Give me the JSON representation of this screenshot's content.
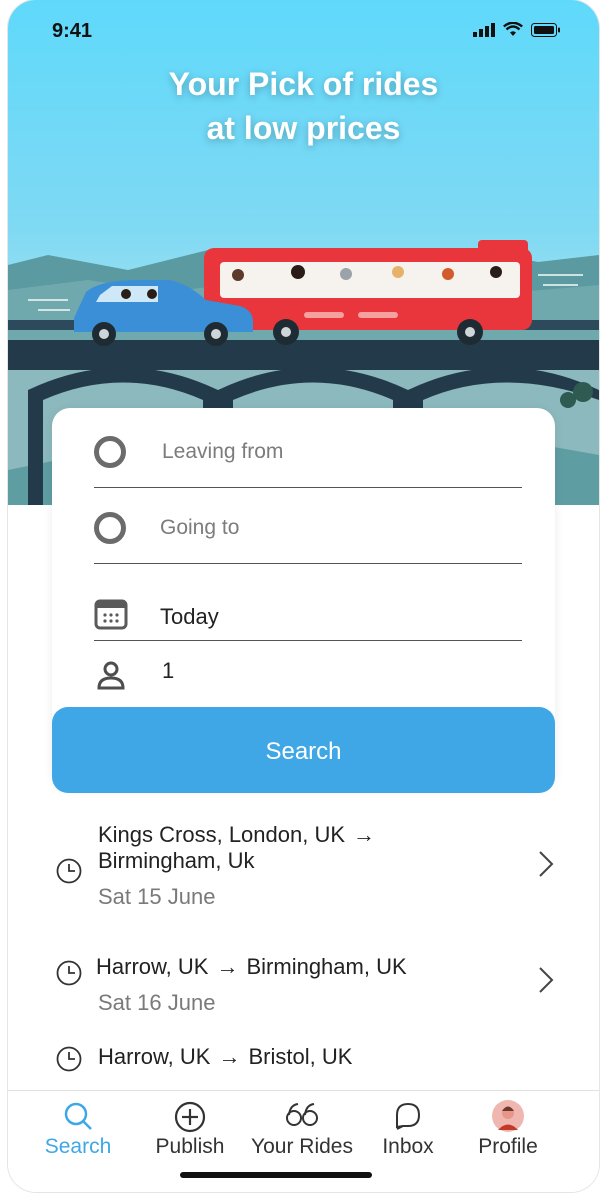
{
  "status": {
    "time": "9:41"
  },
  "hero": {
    "title_line1": "Your Pick of rides",
    "title_line2": "at low prices"
  },
  "search_form": {
    "from_placeholder": "Leaving from",
    "to_placeholder": "Going to",
    "date_value": "Today",
    "passengers_value": "1",
    "search_label": "Search"
  },
  "recent": [
    {
      "from": "Kings Cross, London, UK",
      "to": "Birmingham, Uk",
      "arrow": "→",
      "date": "Sat 15 June"
    },
    {
      "from": "Harrow, UK",
      "to": "Birmingham, UK",
      "arrow": "→",
      "date": "Sat 16 June"
    },
    {
      "from": "Harrow, UK",
      "to": "Bristol, UK",
      "arrow": "→",
      "date": ""
    }
  ],
  "tabs": [
    {
      "label": "Search",
      "icon": "search-icon",
      "active": true
    },
    {
      "label": "Publish",
      "icon": "plus-circle-icon"
    },
    {
      "label": "Your Rides",
      "icon": "quote-icon"
    },
    {
      "label": "Inbox",
      "icon": "chat-icon"
    },
    {
      "label": "Profile",
      "icon": "avatar-icon"
    }
  ],
  "colors": {
    "accent": "#3fa7e6",
    "bus": "#e8363c",
    "car": "#3b8fd6",
    "sky": "#5fd9fb"
  }
}
